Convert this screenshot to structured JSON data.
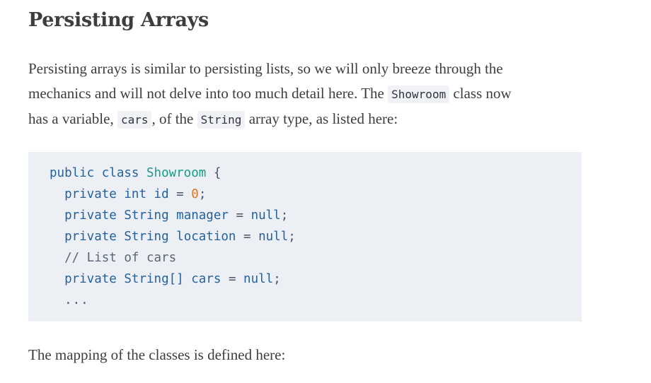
{
  "section": {
    "title": "Persisting Arrays"
  },
  "intro": {
    "line1": "Persisting arrays is similar to persisting lists, so we will only breeze through the",
    "line2_before": "mechanics and will not delve into too much detail here. The ",
    "line2_code": "Showroom",
    "line2_after": " class now",
    "line3_before": "has a variable, ",
    "line3_code1": "cars",
    "line3_mid": ", of the ",
    "line3_code2": "String",
    "line3_after": " array type, as listed here:"
  },
  "code": {
    "l1_kw1": "public",
    "l1_kw2": "class",
    "l1_cls": "Showroom",
    "l1_brace": "{",
    "l2_kw": "private",
    "l2_type": "int",
    "l2_ident": "id",
    "l2_eq": "=",
    "l2_num": "0",
    "l2_semi": ";",
    "l3_kw": "private",
    "l3_type": "String",
    "l3_ident": "manager",
    "l3_eq": "=",
    "l3_val": "null",
    "l3_semi": ";",
    "l4_kw": "private",
    "l4_type": "String",
    "l4_ident": "location",
    "l4_eq": "=",
    "l4_val": "null",
    "l4_semi": ";",
    "l5_comment": "// List of cars",
    "l6_kw": "private",
    "l6_type": "String[]",
    "l6_ident": "cars",
    "l6_eq": "=",
    "l6_val": "null",
    "l6_semi": ";",
    "l7_ellipsis": "..."
  },
  "outro": {
    "text": "The mapping of the classes is defined here:"
  }
}
